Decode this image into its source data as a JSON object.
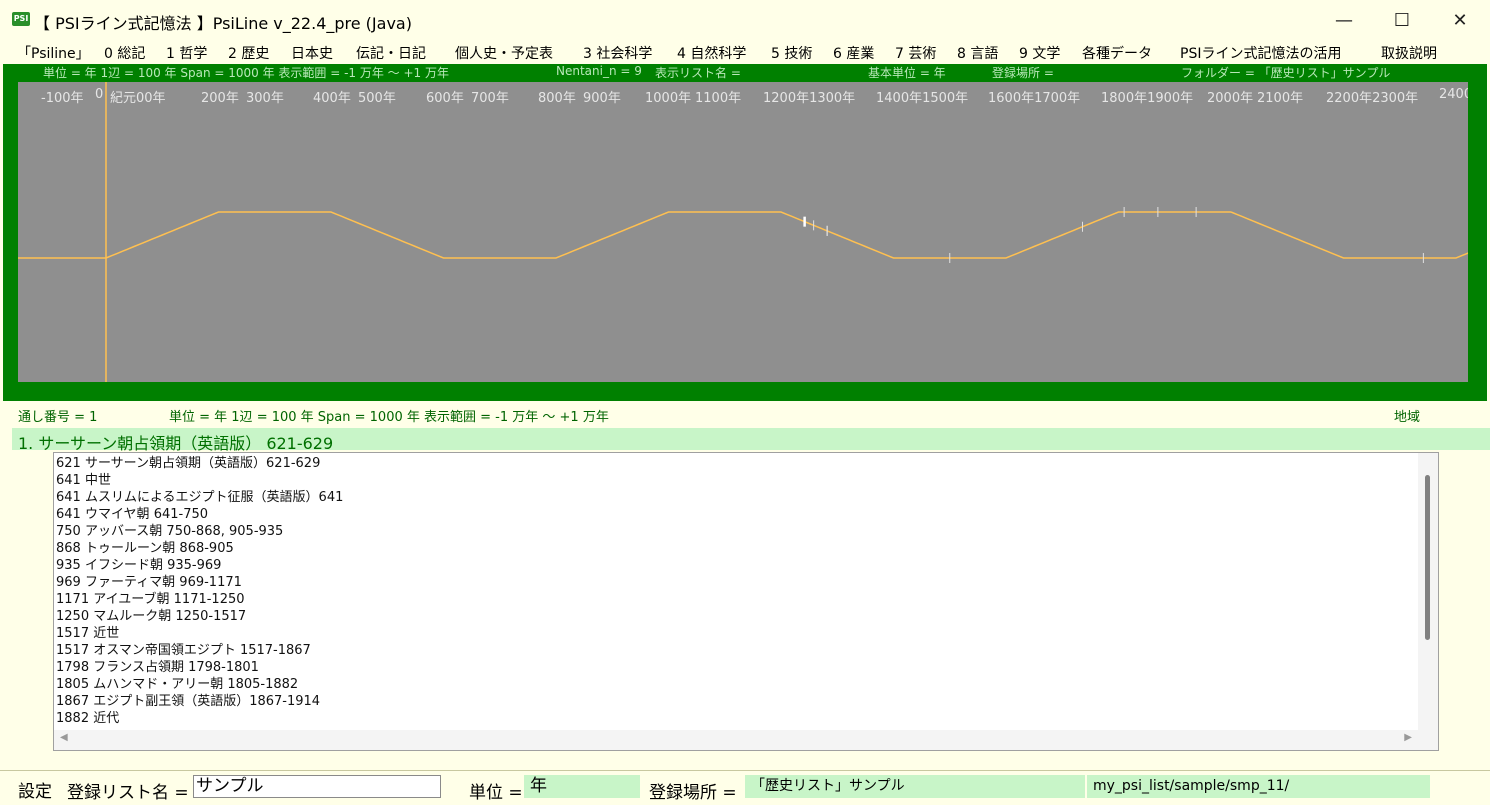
{
  "window": {
    "icon_text": "PSI",
    "title": "【 PSIライン式記憶法 】PsiLine v_22.4_pre (Java)",
    "minimize": "—",
    "maximize": "☐",
    "close": "✕"
  },
  "menu": [
    "「Psiline」",
    "0 総記",
    "1 哲学",
    "2 歴史",
    "日本史",
    "伝記・日記",
    "個人史・予定表",
    "3 社会科学",
    "4 自然科学",
    "5 技術",
    "6 産業",
    "7 芸術",
    "8 言語",
    "9 文学",
    "各種データ",
    "PSIライン式記憶法の活用",
    "取扱説明"
  ],
  "chart_info": {
    "unit": "単位 = 年  1辺 = 100 年  Span = 1000 年  表示範囲 = -1 万年 〜 +1 万年",
    "nentani": "Nentani_n = 9",
    "list_name": "表示リスト名 =",
    "base_unit": "基本単位 = 年",
    "location": "登録場所 =",
    "folder": "フォルダー = 「歴史リスト」サンプル"
  },
  "chart_data": {
    "type": "line",
    "ticks": [
      "-100年",
      "0",
      "紀元00年",
      "200年",
      "300年",
      "400年",
      "500年",
      "600年",
      "700年",
      "800年",
      "900年",
      "1000年",
      "1100年",
      "1200年1300年",
      "1400年1500年",
      "1600年1700年",
      "1800年1900年",
      "2000年",
      "2100年",
      "2200年2300年",
      "2400"
    ],
    "span_years": 1000,
    "edge_years": 100,
    "event_years": [
      621,
      629,
      641,
      641,
      641,
      750,
      868,
      905,
      935,
      969,
      1171,
      1250,
      1517,
      1517,
      1798,
      1801,
      1805,
      1867,
      1882
    ],
    "colors": {
      "line": "#ffc050",
      "canvas": "#8f8f8f",
      "panel": "#008000",
      "marker": "#ffffff"
    }
  },
  "status": {
    "serial": "通し番号 = 1",
    "unit": "単位 = 年  1辺 = 100 年  Span = 1000 年  表示範囲 = -1 万年 〜 +1 万年",
    "region": "地域"
  },
  "selected": {
    "label": "1. サーサーン朝占領期（英語版）  621-629"
  },
  "list_items": [
    "621  サーサーン朝占領期（英語版）621-629",
    "641  中世",
    "641  ムスリムによるエジプト征服（英語版）641",
    "641  ウマイヤ朝 641-750",
    "750  アッバース朝 750-868, 905-935",
    "868  トゥールーン朝 868-905",
    "935  イフシード朝 935-969",
    "969  ファーティマ朝 969-1171",
    "1171  アイユーブ朝 1171-1250",
    "1250  マムルーク朝 1250-1517",
    "1517  近世",
    "1517  オスマン帝国領エジプト 1517-1867",
    "1798  フランス占領期 1798-1801",
    "1805  ムハンマド・アリー朝 1805-1882",
    "1867  エジプト副王領（英語版）1867-1914",
    "1882  近代"
  ],
  "bottom": {
    "setting": "設定",
    "list_name_label": "登録リスト名 =",
    "list_name_value": "サンプル",
    "unit_label": "単位 =",
    "unit_value": "年",
    "location_label": "登録場所 =",
    "location_value": "「歴史リスト」サンプル",
    "path": "my_psi_list/sample/smp_11/"
  }
}
